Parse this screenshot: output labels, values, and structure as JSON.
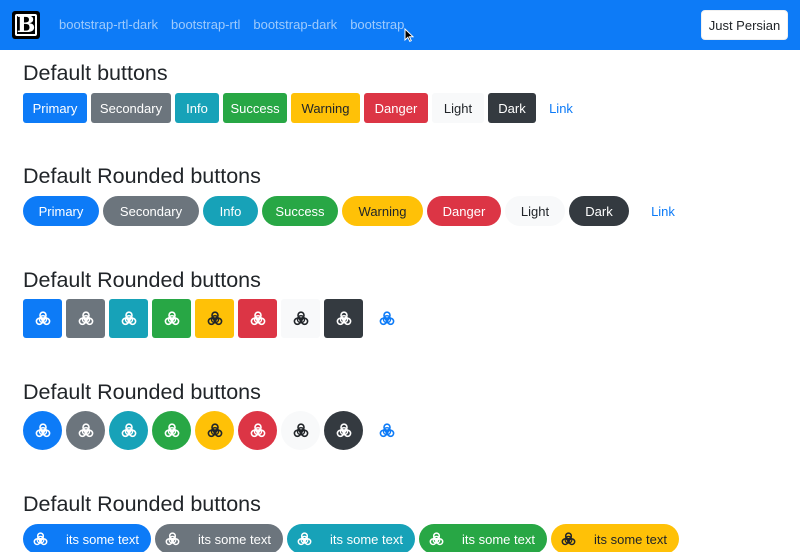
{
  "navbar": {
    "brand": "B",
    "links": [
      "bootstrap-rtl-dark",
      "bootstrap-rtl",
      "bootstrap-dark",
      "bootstrap"
    ],
    "button_label": "Just Persian"
  },
  "sections": {
    "s1": {
      "title": "Default buttons"
    },
    "s2": {
      "title": "Default Rounded buttons"
    },
    "s3": {
      "title": "Default Rounded buttons"
    },
    "s4": {
      "title": "Default Rounded buttons"
    },
    "s5": {
      "title": "Default Rounded buttons"
    }
  },
  "buttons": [
    "Primary",
    "Secondary",
    "Info",
    "Success",
    "Warning",
    "Danger",
    "Light",
    "Dark",
    "Link"
  ],
  "icon_buttons": [
    "primary",
    "secondary",
    "info",
    "success",
    "warning",
    "danger",
    "light",
    "dark",
    "link"
  ],
  "icon_name": "biohazard-icon",
  "text_buttons": {
    "label": "its some text",
    "variants": [
      "primary",
      "secondary",
      "info",
      "success",
      "warning"
    ]
  },
  "colors": {
    "primary": "#0d7bf7",
    "secondary": "#6c757d",
    "info": "#17a2b8",
    "success": "#28a745",
    "warning": "#ffc107",
    "danger": "#dc3545",
    "light": "#f8f9fa",
    "dark": "#343a40"
  }
}
